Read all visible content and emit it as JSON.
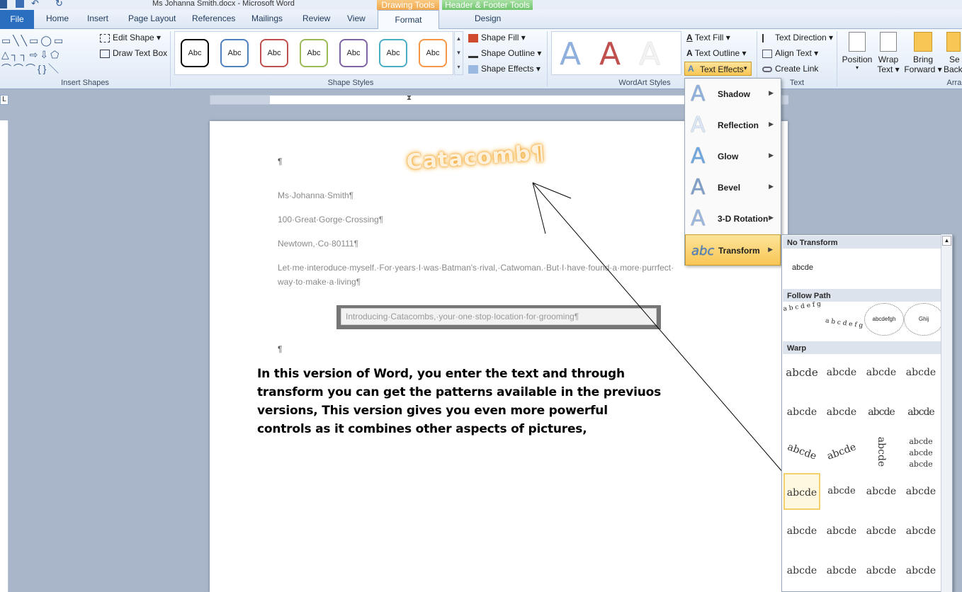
{
  "window": {
    "title": "Ms Johanna Smith.docx  -  Microsoft Word"
  },
  "context_tabs": {
    "drawing_tools": "Drawing Tools",
    "header_footer_tools": "Header & Footer Tools"
  },
  "tabs": [
    "File",
    "Home",
    "Insert",
    "Page Layout",
    "References",
    "Mailings",
    "Review",
    "View",
    "Format",
    "Design"
  ],
  "ribbon": {
    "edit_shape": "Edit Shape",
    "draw_text_box": "Draw Text Box",
    "insert_shapes_label": "Insert Shapes",
    "style_sample": "Abc",
    "shape_styles_label": "Shape Styles",
    "shape_fill": "Shape Fill",
    "shape_outline": "Shape Outline",
    "shape_effects": "Shape Effects",
    "wordart_styles_label": "WordArt Styles",
    "text_fill": "Text Fill",
    "text_outline": "Text Outline",
    "text_effects": "Text Effects",
    "text_direction": "Text Direction",
    "align_text": "Align Text",
    "create_link": "Create Link",
    "text_label": "Text",
    "position": "Position",
    "wrap": "Wrap",
    "wrap2": "Text",
    "bring": "Bring",
    "bring2": "Forward",
    "send": "Se",
    "send2": "Back",
    "arrange_label": "Arran"
  },
  "document": {
    "para_mark": "¶",
    "wordart": "Catacomb¶",
    "name": "Ms·Johanna·Smith¶",
    "address1": "100·Great·Gorge·Crossing¶",
    "address2": "Newtown,·Co·80111¶",
    "body1": "Let·me·interoduce·myself.·For·years·I·was·Batman's·rival,·Catwoman.·But·I·have·found·a·more·purrfect·",
    "body2": "way·to·make·a·living¶",
    "boxed": "Introducing·Catacombs,·your·one·stop·location·for·grooming¶",
    "note1": "In this version of Word, you enter the text and through",
    "note2": "transform you can get the patterns available in the previuos",
    "note3": "versions, This version gives you even more powerful",
    "note4": "controls as it combines other aspects of pictures,"
  },
  "effects_menu": [
    "Shadow",
    "Reflection",
    "Glow",
    "Bevel",
    "3-D Rotation",
    "Transform"
  ],
  "transform_panel": {
    "no_transform": "No Transform",
    "no_transform_sample": "abcde",
    "follow_path": "Follow Path",
    "warp": "Warp",
    "cell": "abcde"
  },
  "colors": {
    "accent": "#f3b33d",
    "tab_active": "#2a6fbf",
    "drawing_tools": "#f0a64a",
    "header_footer": "#6cc36b"
  }
}
